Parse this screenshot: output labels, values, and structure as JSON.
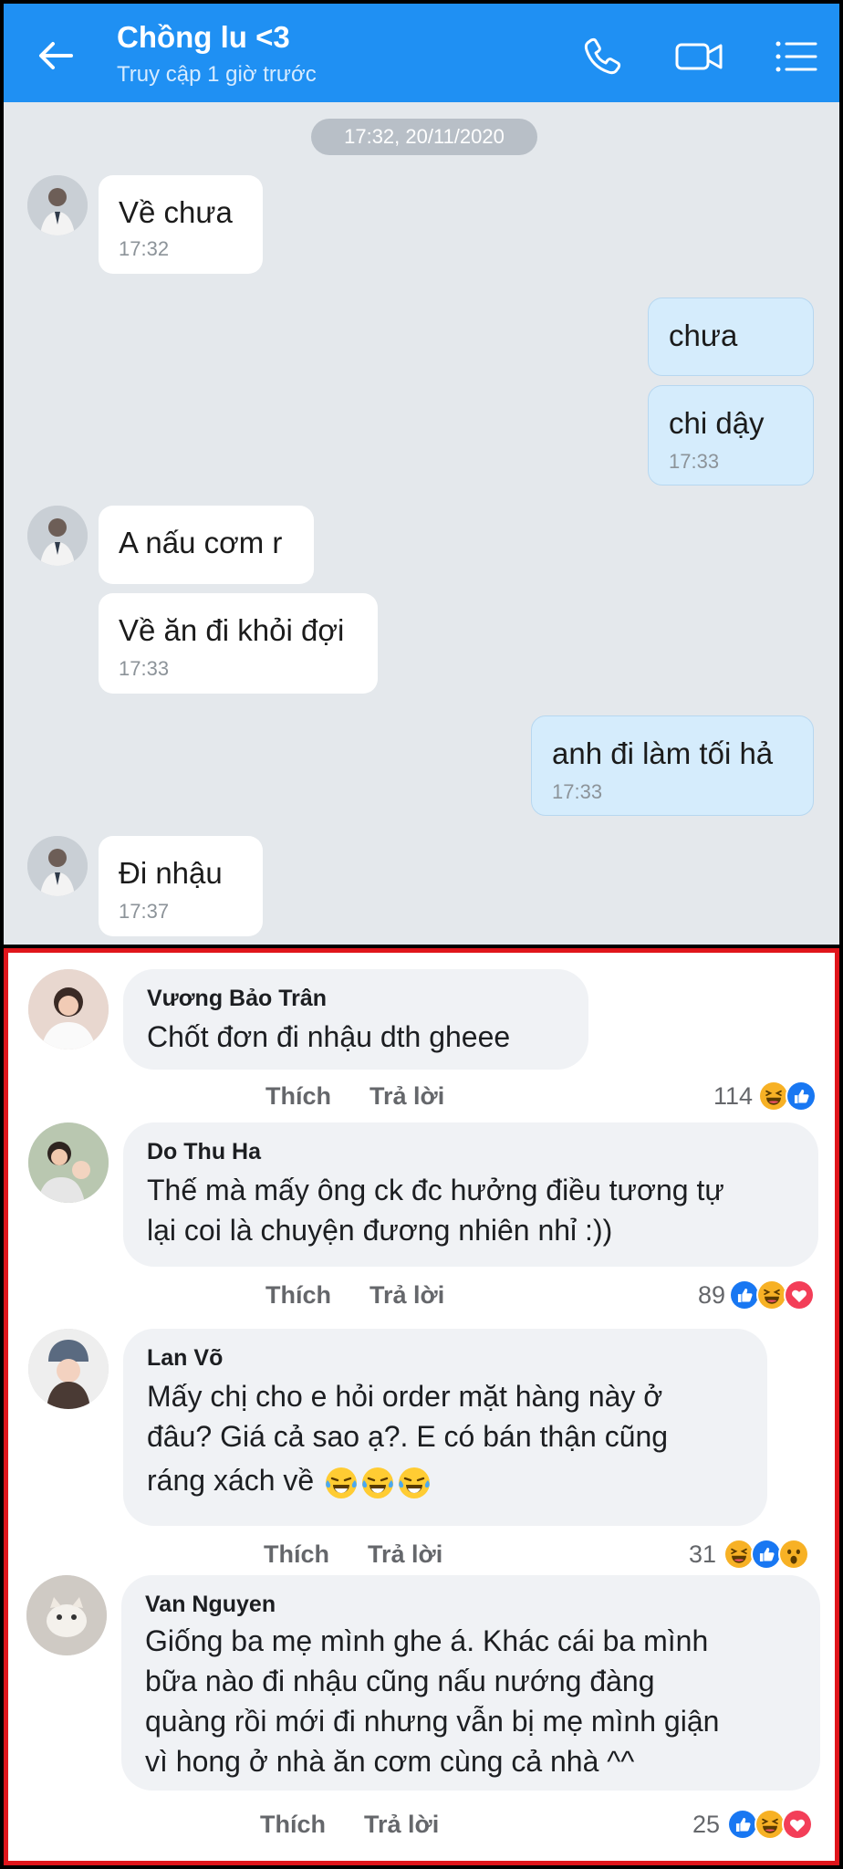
{
  "chat": {
    "header": {
      "title": "Chồng lu <3",
      "subtitle": "Truy cập 1 giờ trước",
      "header_color": "#1f90f3"
    },
    "date_separator": "17:32, 20/11/2020",
    "messages": [
      {
        "side": "in",
        "texts": [
          "Về chưa"
        ],
        "time": "17:32"
      },
      {
        "side": "out",
        "texts": [
          "chưa"
        ],
        "time": ""
      },
      {
        "side": "out",
        "texts": [
          "chi dậy"
        ],
        "time": "17:33"
      },
      {
        "side": "in",
        "texts": [
          "A nấu cơm r"
        ],
        "time": ""
      },
      {
        "side": "in",
        "texts": [
          "Về ăn đi khỏi đợi"
        ],
        "time": "17:33"
      },
      {
        "side": "out",
        "texts": [
          "anh đi làm tối hả"
        ],
        "time": "17:33"
      },
      {
        "side": "in",
        "texts": [
          "Đi nhậu"
        ],
        "time": "17:37"
      }
    ]
  },
  "comments": {
    "frame_color": "#e0151b",
    "like_label": "Thích",
    "reply_label": "Trả lời",
    "items": [
      {
        "name": "Vương Bảo Trân",
        "lines": [
          "Chốt đơn đi nhậu dth gheee"
        ],
        "count": "114",
        "reactions": [
          "haha-icon",
          "like-icon"
        ]
      },
      {
        "name": "Do Thu Ha",
        "lines": [
          "Thế mà mấy ông ck đc hưởng điều tương tự",
          "lại coi là chuyện đương nhiên nhỉ :))"
        ],
        "count": "89",
        "reactions": [
          "like-icon",
          "haha-icon",
          "love-icon"
        ]
      },
      {
        "name": "Lan Võ",
        "lines": [
          "Mấy chị cho e hỏi order mặt hàng này ở",
          "đâu?  Giá cả sao ạ?.  E có bán thận cũng",
          "ráng xách về"
        ],
        "trailing_emoji": [
          "laugh-tears-emoji",
          "laugh-tears-emoji",
          "laugh-tears-emoji"
        ],
        "count": "31",
        "reactions": [
          "haha-icon",
          "like-icon",
          "wow-icon"
        ]
      },
      {
        "name": "Van Nguyen",
        "lines": [
          "Giống ba mẹ mình ghe á. Khác cái ba mình",
          "bữa nào đi nhậu cũng nấu nướng đàng",
          "quàng rồi mới đi nhưng vẫn bị mẹ mình giận",
          "vì hong ở nhà ăn cơm cùng cả nhà ^^"
        ],
        "count": "25",
        "reactions": [
          "like-icon",
          "haha-icon",
          "love-icon"
        ]
      }
    ]
  }
}
